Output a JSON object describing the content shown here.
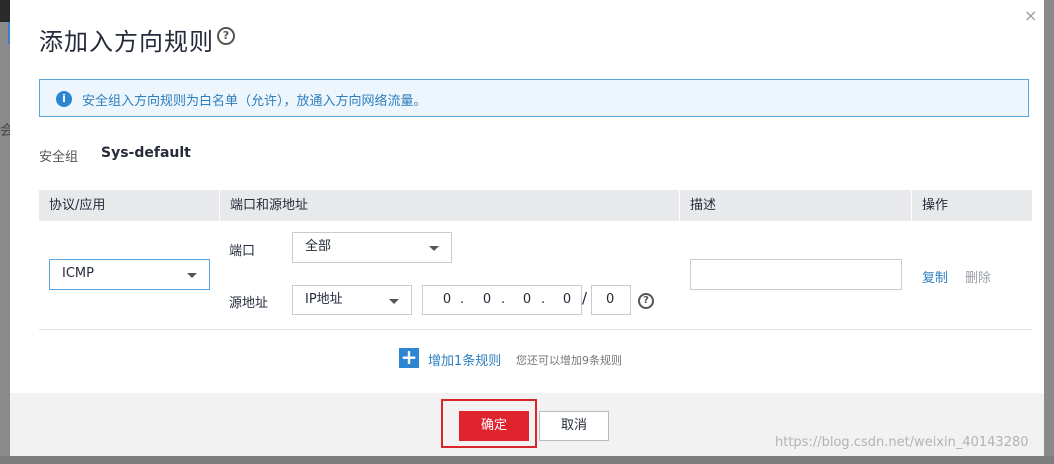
{
  "dialog": {
    "title": "添加入方向规则",
    "help_icon": "question-circle-icon",
    "close_icon": "close-icon",
    "close_glyph": "×"
  },
  "info": {
    "icon": "info-icon",
    "icon_glyph": "i",
    "text": "安全组入方向规则为白名单（允许），放通入方向网络流量。"
  },
  "security_group": {
    "label": "安全组",
    "value": "Sys-default"
  },
  "table": {
    "headers": [
      "协议/应用",
      "端口和源地址",
      "描述",
      "操作"
    ],
    "row": {
      "protocol": "ICMP",
      "port_label": "端口",
      "port_value": "全部",
      "source_label": "源地址",
      "source_type": "IP地址",
      "ip_octets": [
        "0",
        "0",
        "0",
        "0"
      ],
      "ip_separator": ".",
      "mask_separator": "/",
      "mask": "0",
      "description": "",
      "actions": [
        "复制",
        "删除"
      ]
    }
  },
  "add_rule": {
    "icon": "plus-icon",
    "icon_glyph": "+",
    "label": "增加1条规则",
    "hint": "您还可以增加9条规则"
  },
  "footer": {
    "confirm": "确定",
    "cancel": "取消",
    "watermark": "https://blog.csdn.net/weixin_40143280"
  },
  "colors": {
    "primary_button": "#e0242e",
    "link_blue": "#2d7fc0",
    "highlight_border": "#d9262c",
    "info_background": "#eef6fd"
  }
}
